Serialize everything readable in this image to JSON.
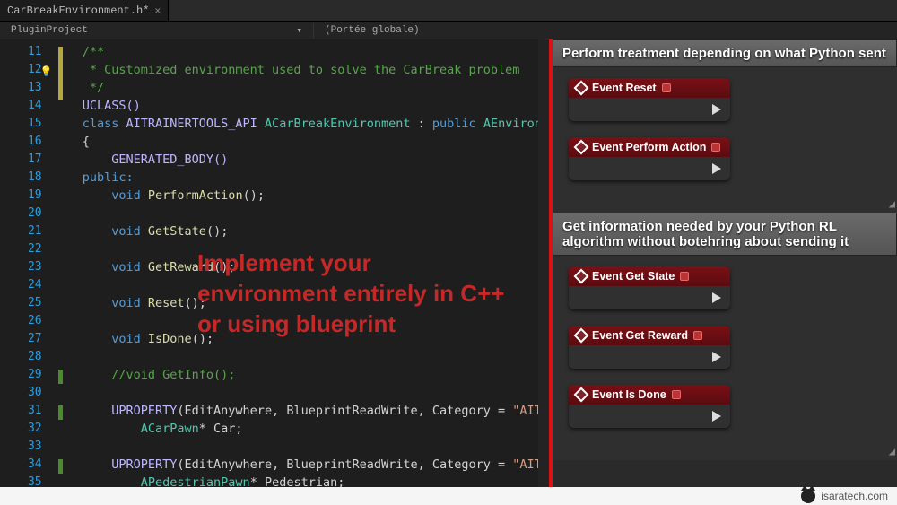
{
  "tab": {
    "title": "CarBreakEnvironment.h*"
  },
  "subrow": {
    "project": "PluginProject",
    "scope": "(Portée globale)"
  },
  "editor": {
    "first_line": 11,
    "lines": [
      {
        "raw": "/**",
        "cls": "c-com"
      },
      {
        "raw": " * Customized environment used to solve the CarBreak problem",
        "cls": "c-com"
      },
      {
        "raw": " */",
        "cls": "c-com"
      },
      {
        "raw": "UCLASS()",
        "cls": "c-mac"
      },
      {
        "raw": "class AITRAINERTOOLS_API ACarBreakEnvironment : public AEnvironm",
        "cls": "mix1"
      },
      {
        "raw": "{",
        "cls": "c-pun"
      },
      {
        "raw": "    GENERATED_BODY()",
        "cls": "c-mac"
      },
      {
        "raw": "public:",
        "cls": "c-key"
      },
      {
        "raw": "    void PerformAction();",
        "cls": "mix2"
      },
      {
        "raw": "",
        "cls": ""
      },
      {
        "raw": "    void GetState();",
        "cls": "mix2"
      },
      {
        "raw": "",
        "cls": ""
      },
      {
        "raw": "    void GetReward();",
        "cls": "mix2"
      },
      {
        "raw": "",
        "cls": ""
      },
      {
        "raw": "    void Reset();",
        "cls": "mix2"
      },
      {
        "raw": "",
        "cls": ""
      },
      {
        "raw": "    void IsDone();",
        "cls": "mix2"
      },
      {
        "raw": "",
        "cls": ""
      },
      {
        "raw": "    //void GetInfo();",
        "cls": "c-com"
      },
      {
        "raw": "",
        "cls": ""
      },
      {
        "raw": "    UPROPERTY(EditAnywhere, BlueprintReadWrite, Category = \"AITr",
        "cls": "mix3"
      },
      {
        "raw": "        ACarPawn* Car;",
        "cls": "mix4"
      },
      {
        "raw": "",
        "cls": ""
      },
      {
        "raw": "    UPROPERTY(EditAnywhere, BlueprintReadWrite, Category = \"AITr",
        "cls": "mix3"
      },
      {
        "raw": "        APedestrianPawn* Pedestrian;",
        "cls": "mix4"
      }
    ],
    "overlay_lines": [
      "Implement your",
      "environment entirely in C++",
      "or using blueprint"
    ]
  },
  "blueprint": {
    "sections": [
      {
        "title": "Perform treatment depending on what Python sent",
        "nodes": [
          "Event Reset",
          "Event Perform Action"
        ]
      },
      {
        "title": "Get information needed by your Python RL algorithm without botehring about sending it",
        "nodes": [
          "Event Get State",
          "Event Get Reward",
          "Event Is Done"
        ]
      }
    ]
  },
  "footer": {
    "brand": "isaratech.com"
  }
}
